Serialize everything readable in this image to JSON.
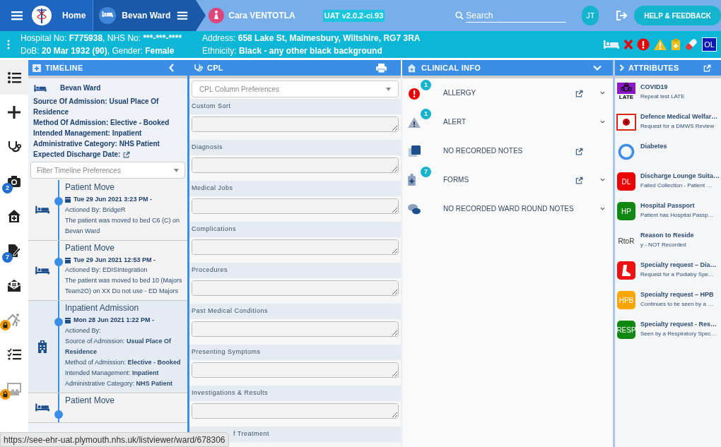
{
  "nav": {
    "home": "Home",
    "ward": "Bevan Ward",
    "patient": "Cara VENTOTLA",
    "version": "UAT v2.0.2-ci.93",
    "search_placeholder": "Search",
    "user_initials": "JT",
    "help_button": "HELP & FEEDBACK"
  },
  "patient_bar": {
    "left": [
      [
        {
          "t": "Hospital No: "
        },
        {
          "t": "F775938",
          "b": true
        },
        {
          "t": ", NHS No: "
        },
        {
          "t": "***-***-****",
          "b": true
        }
      ],
      [
        {
          "t": "DoB: "
        },
        {
          "t": "20 Mar 1932 (90)",
          "b": true
        },
        {
          "t": ", Gender: "
        },
        {
          "t": "Female",
          "b": true
        }
      ]
    ],
    "right": [
      [
        {
          "t": "Address: "
        },
        {
          "t": "658 Lake St, Malmesbury, Wiltshire, RG7 3RA",
          "b": true
        }
      ],
      [
        {
          "t": "Ethnicity: "
        },
        {
          "t": "Black - any other black background",
          "b": true
        }
      ]
    ],
    "status_icons": [
      {
        "kind": "bed"
      },
      {
        "kind": "cross"
      },
      {
        "kind": "alarm"
      },
      {
        "kind": "warning"
      },
      {
        "kind": "clipboard"
      },
      {
        "kind": "pill"
      },
      {
        "kind": "text",
        "label": "OL"
      }
    ]
  },
  "rail": [
    {
      "kind": "list",
      "selected": true,
      "locked": false
    },
    {
      "kind": "plus",
      "selected": false,
      "locked": false
    },
    {
      "kind": "stethoscope",
      "selected": false,
      "locked": false
    },
    {
      "kind": "camera",
      "selected": false,
      "locked": false,
      "badge": "2"
    },
    {
      "kind": "home",
      "selected": false,
      "locked": false
    },
    {
      "kind": "edit",
      "selected": false,
      "locked": false,
      "badge": "7"
    },
    {
      "kind": "mail",
      "selected": false,
      "locked": false
    },
    {
      "kind": "walk",
      "selected": false,
      "locked": true
    },
    {
      "kind": "checklist",
      "selected": false,
      "locked": false
    },
    {
      "kind": "board",
      "selected": false,
      "locked": true
    }
  ],
  "timeline": {
    "title": "TIMELINE",
    "summary": {
      "ward": "Bevan Ward",
      "lines": [
        "Source Of Admission: Usual Place Of Residence",
        "Method Of Admission: Elective - Booked",
        "Intended Management: Inpatient",
        "Administrative Category: NHS Patient"
      ],
      "discharge": "Expected Discharge Date:"
    },
    "filter_placeholder": "Filter Timeline Preferences",
    "entries": [
      {
        "kind": "move",
        "title": "Patient Move",
        "date": "Tue 29 Jun 2021 3:23 PM -",
        "lines": [
          [
            {
              "t": "Actioned By: BridgeR"
            }
          ],
          [
            {
              "t": "The patient was moved to bed C6 (C) on Bevan Ward"
            }
          ]
        ]
      },
      {
        "kind": "move",
        "title": "Patient Move",
        "date": "Tue 29 Jun 2021 12:53 PM -",
        "lines": [
          [
            {
              "t": "Actioned By: EDISIntegration"
            }
          ],
          [
            {
              "t": "The patient was moved to bed 10 (Majors Team2O) on XX Do not use - ED Majors"
            }
          ]
        ]
      },
      {
        "kind": "admission",
        "title": "Inpatient Admission",
        "date": "Mon 28 Jun 2021 1:22 PM -",
        "lines": [
          [
            {
              "t": "Actioned By:"
            }
          ],
          [
            {
              "t": "Source of Admission: "
            },
            {
              "t": "Usual Place Of Residence",
              "b": true
            }
          ],
          [
            {
              "t": "Method of Admission: "
            },
            {
              "t": "Elective - Booked",
              "b": true
            }
          ],
          [
            {
              "t": "Intended Management: "
            },
            {
              "t": "Inpatient",
              "b": true
            }
          ],
          [
            {
              "t": "Administrative Category: "
            },
            {
              "t": "NHS Patient",
              "b": true
            }
          ]
        ]
      },
      {
        "kind": "move",
        "title": "Patient Move"
      }
    ]
  },
  "cpl": {
    "title": "CPL",
    "preferences_placeholder": "CPL Column Preferences",
    "sections": [
      "Custom Sort",
      "Diagnosis",
      "Medical Jobs",
      "Complications",
      "Procedures",
      "Past Medical Conditions",
      "Presenting Symptoms",
      "Investigations & Results",
      "f Treatment"
    ]
  },
  "clinical_info": {
    "title": "CLINICAL INFO",
    "items": [
      {
        "kind": "allergy",
        "label": "ALLERGY",
        "badge": "1",
        "external": true,
        "expandable": true
      },
      {
        "kind": "alert",
        "label": "ALERT",
        "badge": "1",
        "external": false,
        "expandable": true
      },
      {
        "kind": "notes",
        "label": "NO RECORDED NOTES",
        "external": true,
        "expandable": false
      },
      {
        "kind": "forms",
        "label": "FORMS",
        "badge": "7",
        "external": true,
        "expandable": true
      },
      {
        "kind": "chat",
        "label": "NO RECORDED WARD ROUND NOTES",
        "external": false,
        "expandable": true
      }
    ]
  },
  "attributes": {
    "title": "ATTRIBUTES",
    "items": [
      {
        "kind": "covid",
        "badge_text": "LATE",
        "title": "COVID19",
        "subtitle": "Repeat test LATE"
      },
      {
        "kind": "poppy",
        "title": "Defence Medical Welfar…",
        "subtitle": "Request for a DMWS Review"
      },
      {
        "kind": "ring",
        "title": "Diabetes"
      },
      {
        "kind": "tile",
        "color": "#ee0000",
        "badge_text": "DL",
        "title": "Discharge Lounge Suita…",
        "subtitle": "Failed Collection - Patient …"
      },
      {
        "kind": "tile",
        "color": "#118811",
        "badge_text": "HP",
        "title": "Hospital Passport",
        "subtitle": "Patient has Hospital Passp…"
      },
      {
        "kind": "plain",
        "badge_text": "RtoR",
        "title": "Reason to Reside",
        "subtitle": "y - NOT Recorded"
      },
      {
        "kind": "foot",
        "title": "Specialty request – Dia…",
        "subtitle": "Request for a Podiatry Spe…"
      },
      {
        "kind": "tile",
        "color": "#ffa500",
        "badge_text": "HPB",
        "title": "Specialty request – HPB",
        "subtitle": "Continues to be seen by a …"
      },
      {
        "kind": "tile",
        "color": "#118811",
        "badge_text": "RESP",
        "title": "Specialty request - Res…",
        "subtitle": "Seen by a Respiratory Spec…"
      }
    ]
  },
  "status_url": "https://see-ehr-uat.plymouth.nhs.uk/listviewer/ward/678306"
}
